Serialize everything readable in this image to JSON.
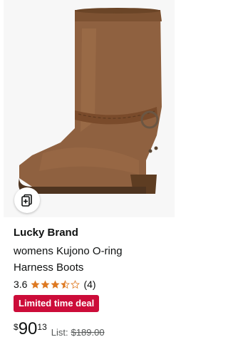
{
  "product": {
    "image_alt": "brown suede harness boot with braided strap and O-ring",
    "brand": "Lucky Brand",
    "title_lines": [
      "womens Kujono O-ring",
      "Harness Boots"
    ],
    "rating": "3.6",
    "stars_filled": 3.5,
    "stars_total": 5,
    "review_count": "(4)",
    "deal_badge": "Limited time deal",
    "price": {
      "currency": "$",
      "whole": "90",
      "fraction": "13"
    },
    "list_label": "List:",
    "list_price": "$189.00"
  },
  "icons": {
    "compare": "compare-cards-icon",
    "star_full": "star-full-icon",
    "star_half": "star-half-icon",
    "star_empty": "star-empty-icon"
  },
  "colors": {
    "deal_red": "#cc0c39",
    "star_orange": "#de7921",
    "text": "#0f1111",
    "muted": "#565959"
  }
}
